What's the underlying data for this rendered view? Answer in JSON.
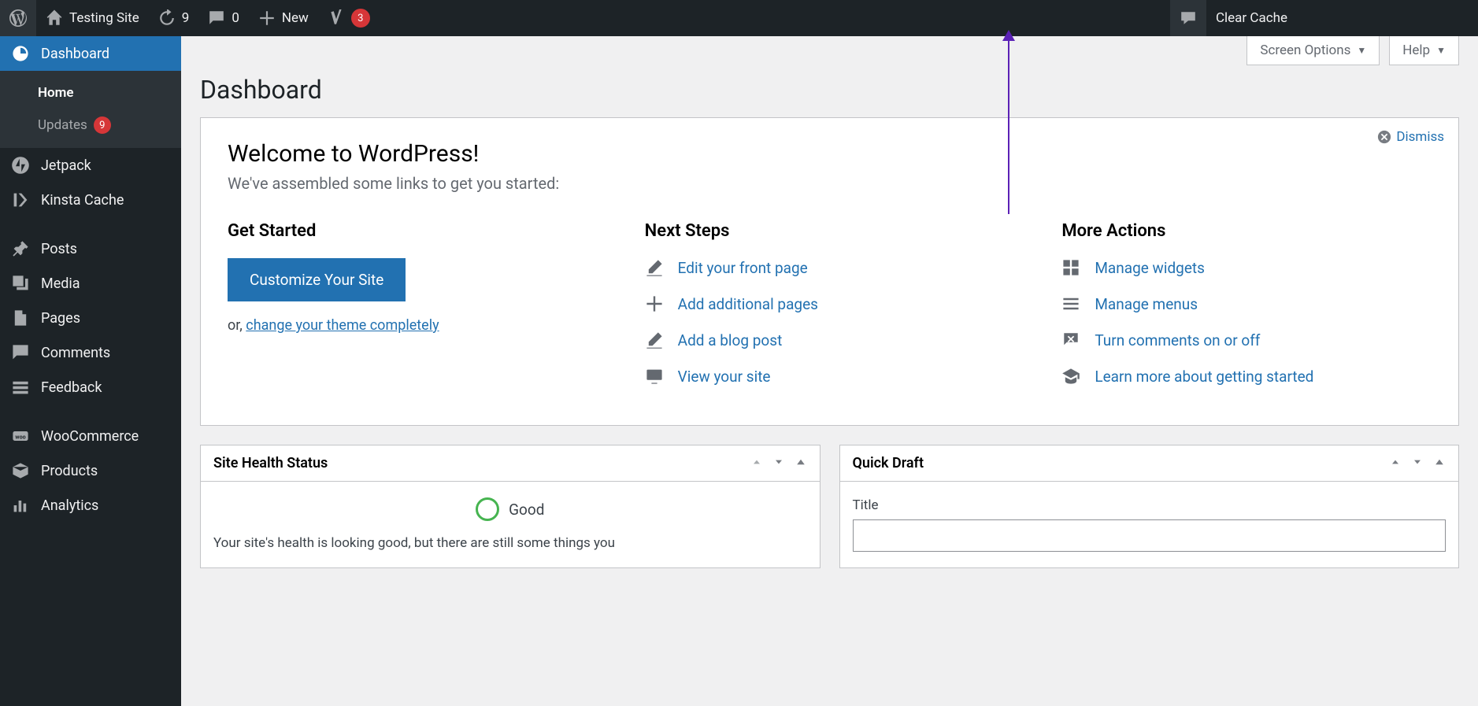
{
  "adminbar": {
    "site_name": "Testing Site",
    "updates_count": "9",
    "comments_count": "0",
    "new_label": "New",
    "yoast_count": "3",
    "clear_cache": "Clear Cache"
  },
  "top_tabs": {
    "screen_options": "Screen Options",
    "help": "Help"
  },
  "page_title": "Dashboard",
  "sidebar": {
    "dashboard": "Dashboard",
    "home": "Home",
    "updates": "Updates",
    "updates_count": "9",
    "items": [
      {
        "label": "Jetpack",
        "icon": "jetpack"
      },
      {
        "label": "Kinsta Cache",
        "icon": "kinsta"
      },
      {
        "label": "Posts",
        "icon": "pin"
      },
      {
        "label": "Media",
        "icon": "media"
      },
      {
        "label": "Pages",
        "icon": "pages"
      },
      {
        "label": "Comments",
        "icon": "comment"
      },
      {
        "label": "Feedback",
        "icon": "feedback"
      },
      {
        "label": "WooCommerce",
        "icon": "woo"
      },
      {
        "label": "Products",
        "icon": "products"
      },
      {
        "label": "Analytics",
        "icon": "analytics"
      }
    ]
  },
  "welcome": {
    "title": "Welcome to WordPress!",
    "subtitle": "We've assembled some links to get you started:",
    "dismiss": "Dismiss",
    "col1": {
      "heading": "Get Started",
      "button": "Customize Your Site",
      "or": "or, ",
      "change_theme": "change your theme completely"
    },
    "col2": {
      "heading": "Next Steps",
      "links": [
        "Edit your front page",
        "Add additional pages",
        "Add a blog post",
        "View your site"
      ]
    },
    "col3": {
      "heading": "More Actions",
      "links": [
        "Manage widgets",
        "Manage menus",
        "Turn comments on or off",
        "Learn more about getting started"
      ]
    }
  },
  "widgets": {
    "health": {
      "title": "Site Health Status",
      "status": "Good",
      "text": "Your site's health is looking good, but there are still some things you"
    },
    "quickdraft": {
      "title": "Quick Draft",
      "title_label": "Title"
    }
  }
}
